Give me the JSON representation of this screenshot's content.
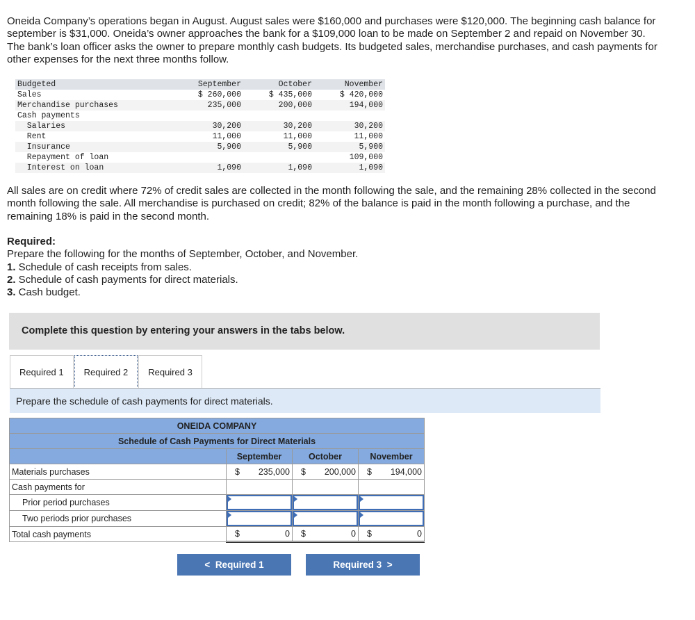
{
  "intro": "Oneida Company’s operations began in August. August sales were $160,000 and purchases were $120,000. The beginning cash balance for september is $31,000. Oneida’s owner approaches the bank for a $109,000 loan to be made on September 2 and repaid on November 30. The bank’s loan officer asks the owner to prepare monthly cash budgets. Its budgeted sales, merchandise purchases, and cash payments for other expenses for the next three months follow.",
  "budget": {
    "header": [
      "Budgeted",
      "September",
      "October",
      "November"
    ],
    "rows": [
      [
        "Sales",
        "$ 260,000",
        "$ 435,000",
        "$ 420,000"
      ],
      [
        "Merchandise purchases",
        "235,000",
        "200,000",
        "194,000"
      ],
      [
        "Cash payments",
        "",
        "",
        ""
      ],
      [
        "  Salaries",
        "30,200",
        "30,200",
        "30,200"
      ],
      [
        "  Rent",
        "11,000",
        "11,000",
        "11,000"
      ],
      [
        "  Insurance",
        "5,900",
        "5,900",
        "5,900"
      ],
      [
        "  Repayment of loan",
        "",
        "",
        "109,000"
      ],
      [
        "  Interest on loan",
        "1,090",
        "1,090",
        "1,090"
      ]
    ]
  },
  "terms": "All sales are on credit where 72% of credit sales are collected in the month following the sale, and the remaining 28% collected in the second month following the sale. All merchandise is purchased on credit; 82% of the balance is paid in the month following a purchase, and the remaining 18% is paid in the second month.",
  "required": {
    "title": "Required:",
    "intro": "Prepare the following for the months of September, October, and November.",
    "items": [
      {
        "num": "1.",
        "text": " Schedule of cash receipts from sales."
      },
      {
        "num": "2.",
        "text": " Schedule of cash payments for direct materials."
      },
      {
        "num": "3.",
        "text": " Cash budget."
      }
    ]
  },
  "instruction_box": "Complete this question by entering your answers in the tabs below.",
  "tabs": [
    "Required 1",
    "Required 2",
    "Required 3"
  ],
  "active_tab": "Required 2",
  "tab_instruction": "Prepare the schedule of cash payments for direct materials.",
  "schedule": {
    "company": "ONEIDA COMPANY",
    "title": "Schedule of Cash Payments for Direct Materials",
    "columns": [
      "September",
      "October",
      "November"
    ],
    "materials_label": "Materials purchases",
    "materials": [
      "235,000",
      "200,000",
      "194,000"
    ],
    "cash_payments_label": "Cash payments for",
    "prior_label": "Prior period purchases",
    "prior": [
      "",
      "",
      ""
    ],
    "two_prior_label": "Two periods prior purchases",
    "two_prior": [
      "",
      "",
      ""
    ],
    "total_label": "Total cash payments",
    "total": [
      "0",
      "0",
      "0"
    ],
    "currency": "$"
  },
  "nav": {
    "prev": "Required 1",
    "next": "Required 3"
  }
}
